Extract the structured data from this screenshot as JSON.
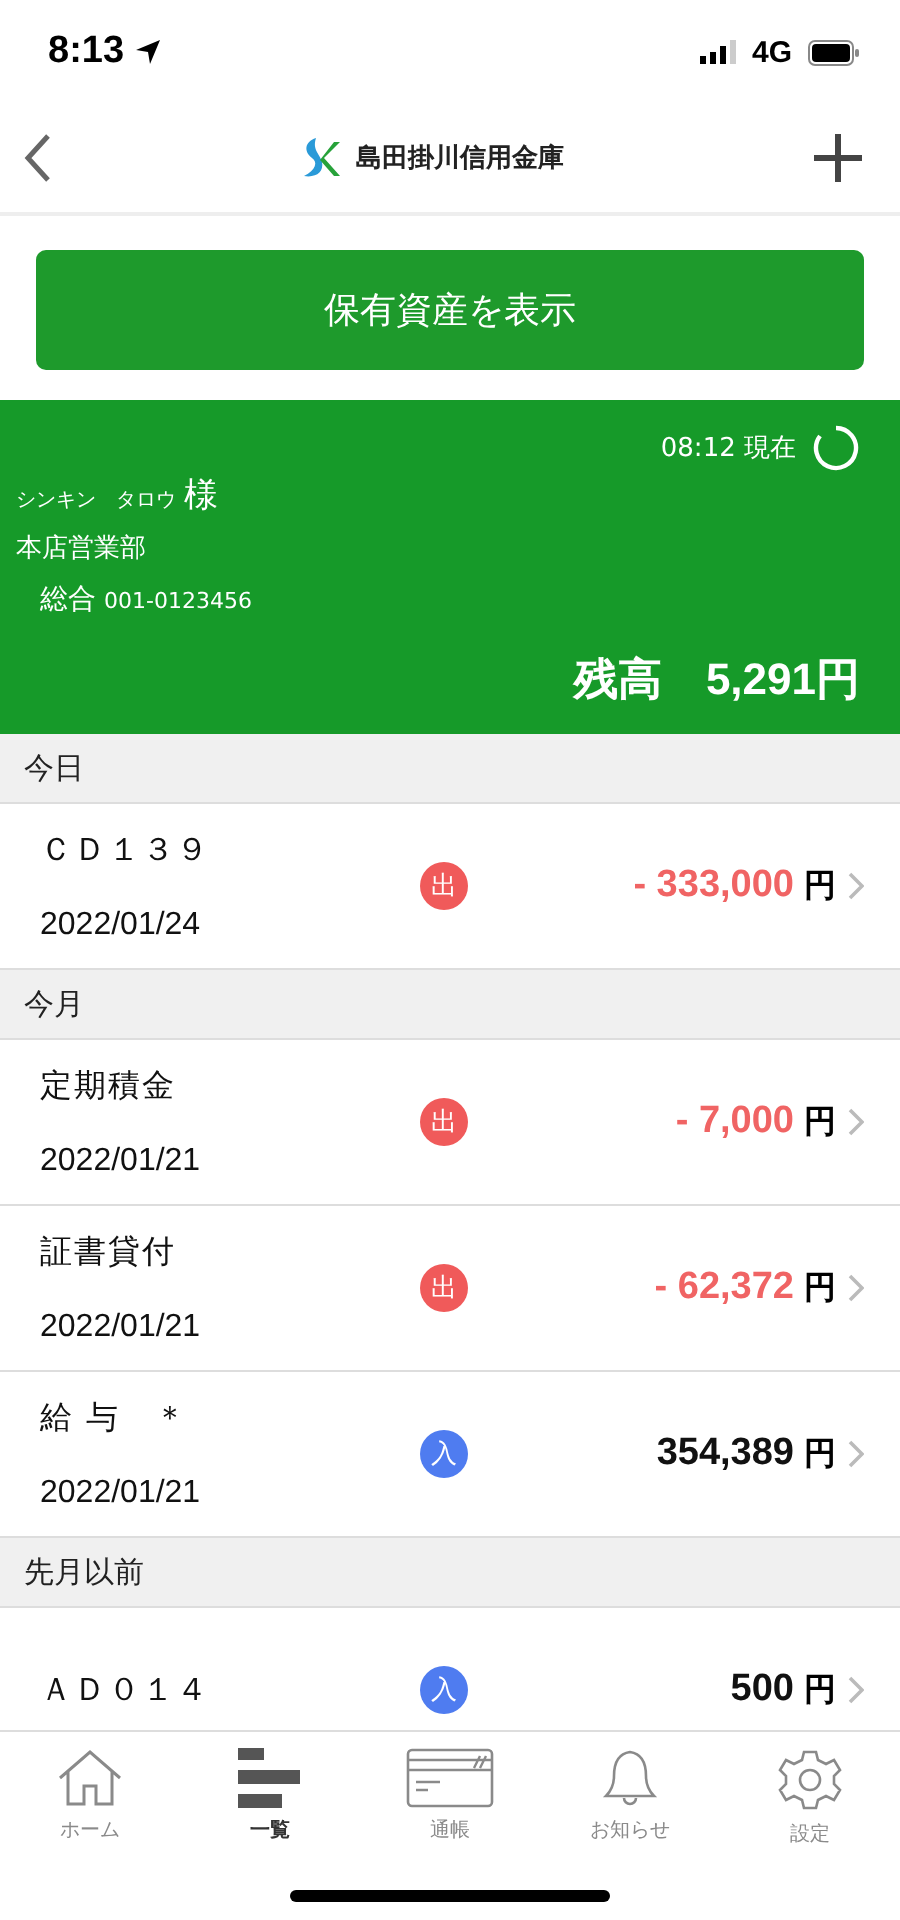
{
  "status_bar": {
    "time": "8:13",
    "network": "4G"
  },
  "header": {
    "title": "島田掛川信用金庫"
  },
  "show_assets_button": "保有資産を表示",
  "account": {
    "as_of": "08:12 現在",
    "name_kana": "シンキン　タロウ",
    "honorific": "様",
    "branch": "本店営業部",
    "account_type": "総合",
    "account_number": "001-0123456",
    "balance_label": "残高",
    "balance": "5,291円"
  },
  "sections": [
    {
      "title": "今日",
      "transactions": [
        {
          "description": "ＣＤ１３９",
          "date": "2022/01/24",
          "kind": "out",
          "badge": "出",
          "amount": "- 333,000",
          "unit": "円"
        }
      ]
    },
    {
      "title": "今月",
      "transactions": [
        {
          "description": "定期積金",
          "date": "2022/01/21",
          "kind": "out",
          "badge": "出",
          "amount": "- 7,000",
          "unit": "円"
        },
        {
          "description": "証書貸付",
          "date": "2022/01/21",
          "kind": "out",
          "badge": "出",
          "amount": "- 62,372",
          "unit": "円"
        },
        {
          "description": "給 与　＊",
          "date": "2022/01/21",
          "kind": "in",
          "badge": "入",
          "amount": "354,389",
          "unit": "円"
        }
      ]
    },
    {
      "title": "先月以前",
      "transactions": [
        {
          "description": "ＡＤ０１４",
          "kind": "in",
          "badge": "入",
          "amount": "500",
          "unit": "円"
        }
      ]
    }
  ],
  "tab_bar": [
    {
      "label": "ホーム",
      "selected": false
    },
    {
      "label": "一覧",
      "selected": true
    },
    {
      "label": "通帳",
      "selected": false
    },
    {
      "label": "お知らせ",
      "selected": false
    },
    {
      "label": "設定",
      "selected": false
    }
  ]
}
